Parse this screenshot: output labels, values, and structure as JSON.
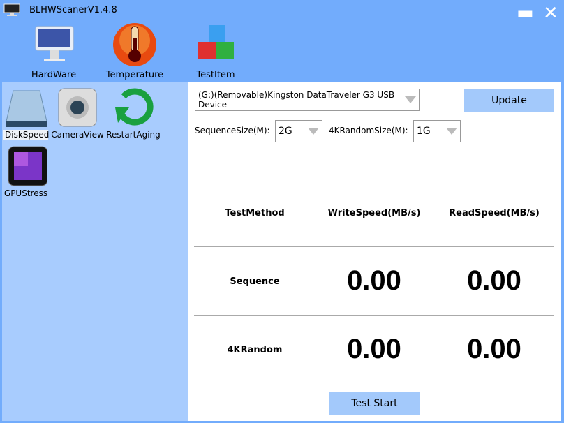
{
  "window": {
    "title": "BLHWScanerV1.4.8",
    "minimize": "▬",
    "close": "✕"
  },
  "toolbar": [
    {
      "label": "HardWare",
      "icon": "monitor-icon"
    },
    {
      "label": "Temperature",
      "icon": "thermometer-icon"
    },
    {
      "label": "TestItem",
      "icon": "cubes-icon"
    }
  ],
  "sidebar": [
    {
      "label": "DiskSpeed",
      "icon": "disk-icon",
      "selected": true
    },
    {
      "label": "CameraView",
      "icon": "camera-icon"
    },
    {
      "label": "RestartAging",
      "icon": "restart-icon"
    },
    {
      "label": "GPUStress",
      "icon": "gpu-icon"
    }
  ],
  "main": {
    "device": "(G:)(Removable)Kingston DataTraveler G3 USB Device",
    "update": "Update",
    "seq_label": "SequenceSize(M):",
    "seq_value": "2G",
    "rand_label": "4KRandomSize(M):",
    "rand_value": "1G",
    "headers": [
      "TestMethod",
      "WriteSpeed(MB/s)",
      "ReadSpeed(MB/s)"
    ],
    "rows": [
      {
        "method": "Sequence",
        "write": "0.00",
        "read": "0.00"
      },
      {
        "method": "4KRandom",
        "write": "0.00",
        "read": "0.00"
      }
    ],
    "start": "Test Start"
  }
}
